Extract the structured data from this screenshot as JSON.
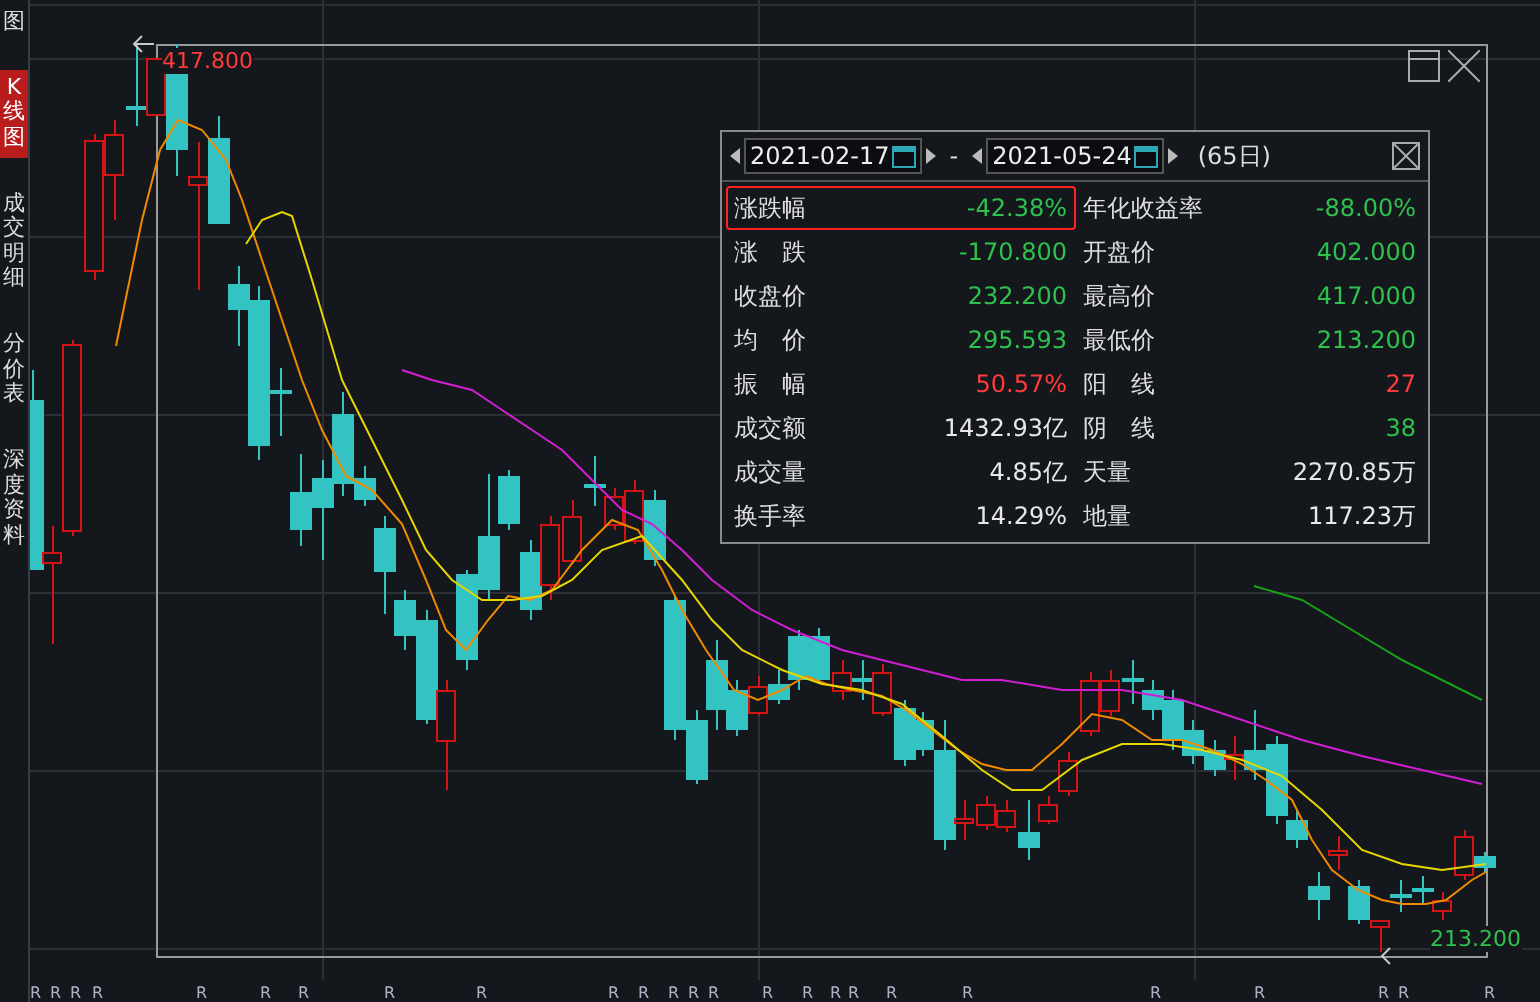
{
  "sidebar": {
    "tabs": [
      {
        "label": "图",
        "selected": false
      },
      {
        "label": "K线图",
        "selected": true
      },
      {
        "label": "成交明细",
        "selected": false
      },
      {
        "label": "分价表",
        "selected": false
      },
      {
        "label": "深度资料",
        "selected": false
      }
    ]
  },
  "chart": {
    "high_label": "417.800",
    "low_label": "213.200",
    "markers": [
      "R",
      "R",
      "R",
      "R",
      "R",
      "R",
      "R",
      "R",
      "R",
      "R",
      "R",
      "R",
      "R",
      "R",
      "R",
      "R",
      "R",
      "R",
      "R",
      "R",
      "R",
      "R",
      "R",
      "R",
      "R"
    ]
  },
  "stats_panel": {
    "start_date": "2021-02-17",
    "separator": "-",
    "end_date": "2021-05-24",
    "days": "(65日)",
    "left_column": [
      {
        "label": "涨跌幅",
        "value": "-42.38%",
        "color": "#2fc14e",
        "highlighted": true
      },
      {
        "label": "涨　跌",
        "value": "-170.800",
        "color": "#2fc14e",
        "highlighted": false
      },
      {
        "label": "收盘价",
        "value": "232.200",
        "color": "#2fc14e",
        "highlighted": false
      },
      {
        "label": "均　价",
        "value": "295.593",
        "color": "#2fc14e",
        "highlighted": false
      },
      {
        "label": "振　幅",
        "value": "50.57%",
        "color": "#ff3b3b",
        "highlighted": false
      },
      {
        "label": "成交额",
        "value": "1432.93亿",
        "color": "#e8e8e8",
        "highlighted": false
      },
      {
        "label": "成交量",
        "value": "4.85亿",
        "color": "#e8e8e8",
        "highlighted": false
      },
      {
        "label": "换手率",
        "value": "14.29%",
        "color": "#e8e8e8",
        "highlighted": false
      }
    ],
    "right_column": [
      {
        "label": "年化收益率",
        "value": "-88.00%",
        "color": "#2fc14e",
        "highlighted": false
      },
      {
        "label": "开盘价",
        "value": "402.000",
        "color": "#2fc14e",
        "highlighted": false
      },
      {
        "label": "最高价",
        "value": "417.000",
        "color": "#2fc14e",
        "highlighted": false
      },
      {
        "label": "最低价",
        "value": "213.200",
        "color": "#2fc14e",
        "highlighted": false
      },
      {
        "label": "阳　线",
        "value": "27",
        "color": "#ff3b3b",
        "highlighted": false
      },
      {
        "label": "阴　线",
        "value": "38",
        "color": "#2fc14e",
        "highlighted": false
      },
      {
        "label": "天量",
        "value": "2270.85万",
        "color": "#e8e8e8",
        "highlighted": false
      },
      {
        "label": "地量",
        "value": "117.23万",
        "color": "#e8e8e8",
        "highlighted": false
      }
    ]
  }
}
